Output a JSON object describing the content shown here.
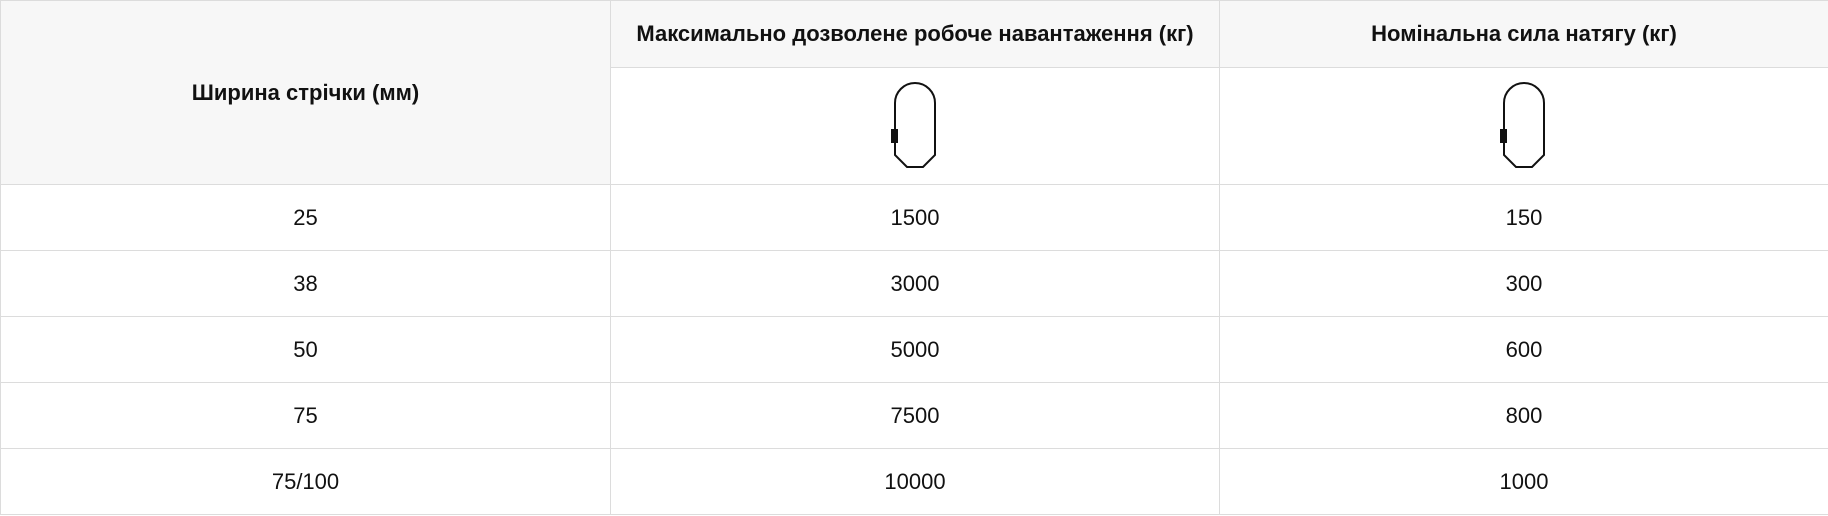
{
  "table": {
    "headers": {
      "width": "Ширина стрічки (мм)",
      "max_load": "Максимально дозволене робоче навантаження (кг)",
      "tension": "Номінальна сила натягу (кг)"
    },
    "icons": {
      "max_load": "strap-loop-icon",
      "tension": "strap-loop-icon"
    },
    "rows": [
      {
        "width": "25",
        "max_load": "1500",
        "tension": "150"
      },
      {
        "width": "38",
        "max_load": "3000",
        "tension": "300"
      },
      {
        "width": "50",
        "max_load": "5000",
        "tension": "600"
      },
      {
        "width": "75",
        "max_load": "7500",
        "tension": "800"
      },
      {
        "width": "75/100",
        "max_load": "10000",
        "tension": "1000"
      }
    ]
  }
}
